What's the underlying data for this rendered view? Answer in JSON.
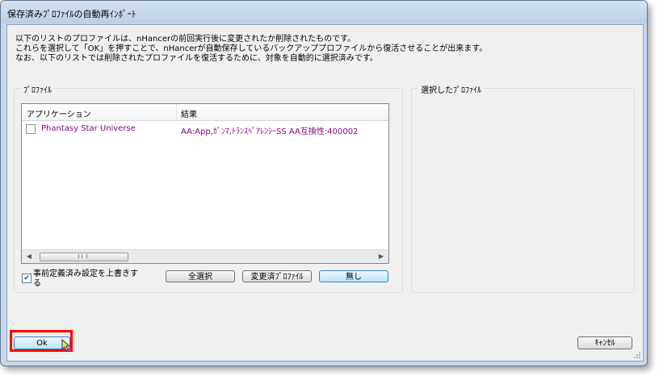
{
  "window": {
    "title": "保存済みﾌﾟﾛﾌｧｲﾙの自動再ｲﾝﾎﾟｰﾄ"
  },
  "intro": {
    "lines": [
      "以下のリストのプロファイルは、nHancerの前回実行後に変更されたか削除されたものです。",
      "これらを選択して「OK」を押すことで、nHancerが自動保存しているバックアッププロファイルから復活させることが出来ます。",
      "なお、以下のリストでは削除されたプロファイルを復活するために、対象を自動的に選択済みです。"
    ]
  },
  "profile_group": {
    "label": "ﾌﾟﾛﾌｧｲﾙ"
  },
  "selected_group": {
    "label": "選択したﾌﾟﾛﾌｧｲﾙ"
  },
  "list": {
    "columns": [
      "アプリケーション",
      "結果"
    ],
    "rows": [
      {
        "application": "Phantasy Star Universe",
        "result": "AA:App,ｶﾞﾝﾏ,ﾄﾗﾝｽﾍﾟｱﾚﾝｼｰSS AA互換性:400002",
        "checked": false
      }
    ]
  },
  "overwrite_checkbox": {
    "label": "事前定義済み設定を上書きする",
    "checked": true
  },
  "buttons": {
    "select_all": "全選択",
    "changed_profiles": "変更済ﾌﾟﾛﾌｧｲﾙ",
    "none": "無し",
    "ok": "Ok",
    "cancel": "ｷｬﾝｾﾙ"
  },
  "colors": {
    "row_text": "#8b008b",
    "highlight_frame": "#ff0000",
    "window_frame": "#c8d8ea"
  }
}
